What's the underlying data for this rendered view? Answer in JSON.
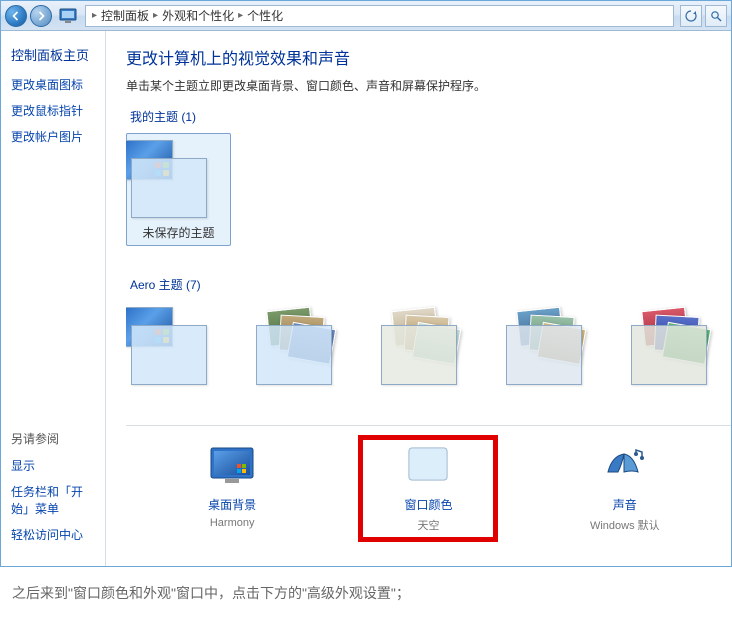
{
  "breadcrumb": {
    "items": [
      "控制面板",
      "外观和个性化",
      "个性化"
    ]
  },
  "sidebar": {
    "primary": "控制面板主页",
    "links": [
      "更改桌面图标",
      "更改鼠标指针",
      "更改帐户图片"
    ],
    "footer_label": "另请参阅",
    "footer_links": [
      "显示",
      "任务栏和「开始」菜单",
      "轻松访问中心"
    ]
  },
  "main": {
    "title": "更改计算机上的视觉效果和声音",
    "subtitle": "单击某个主题立即更改桌面背景、窗口颜色、声音和屏幕保护程序。",
    "section1_label": "我的主题 (1)",
    "my_themes": [
      {
        "name": "未保存的主题"
      }
    ],
    "section2_label": "Aero 主题 (7)",
    "aero_themes": [
      {
        "name": ""
      },
      {
        "name": ""
      },
      {
        "name": ""
      },
      {
        "name": ""
      },
      {
        "name": ""
      }
    ],
    "settings": [
      {
        "title": "桌面背景",
        "sub": "Harmony",
        "icon": "desktop"
      },
      {
        "title": "窗口颜色",
        "sub": "天空",
        "icon": "color"
      },
      {
        "title": "声音",
        "sub": "Windows 默认",
        "icon": "sound"
      }
    ]
  },
  "caption": "之后来到\"窗口颜色和外观\"窗口中，点击下方的\"高级外观设置\"；"
}
